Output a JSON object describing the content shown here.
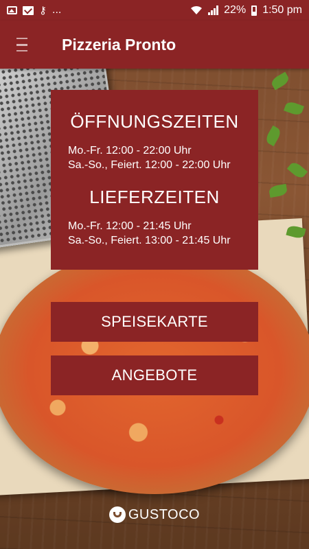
{
  "status_bar": {
    "left_icons": [
      "image-icon",
      "mail-icon",
      "key-icon"
    ],
    "overflow": "...",
    "battery": "22%",
    "time": "1:50 pm"
  },
  "app_bar": {
    "title": "Pizzeria Pronto"
  },
  "opening_hours": {
    "heading": "ÖFFNUNGSZEITEN",
    "lines": [
      "Mo.-Fr. 12:00 - 22:00 Uhr",
      "Sa.-So., Feiert. 12:00 - 22:00 Uhr"
    ]
  },
  "delivery_hours": {
    "heading": "LIEFERZEITEN",
    "lines": [
      "Mo.-Fr. 12:00 - 21:45 Uhr",
      "Sa.-So., Feiert. 13:00 - 21:45 Uhr"
    ]
  },
  "buttons": {
    "menu": "SPEISEKARTE",
    "offers": "ANGEBOTE"
  },
  "brand": {
    "name": "GUSTOCO"
  },
  "colors": {
    "primary": "#8b2425"
  }
}
